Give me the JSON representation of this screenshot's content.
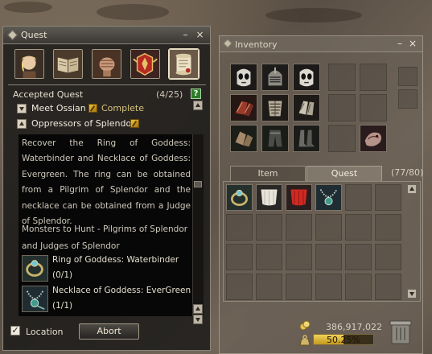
{
  "quest_window": {
    "title": "Quest",
    "minimize": "–",
    "close": "×",
    "tabs": [
      {
        "icon": "elf-portrait-icon"
      },
      {
        "icon": "open-book-icon"
      },
      {
        "icon": "fist-icon"
      },
      {
        "icon": "winged-banner-icon"
      },
      {
        "icon": "scroll-icon",
        "active": true
      }
    ],
    "accepted_label": "Accepted Quest",
    "accepted_count": "(4/25)",
    "help": "?",
    "quests": [
      {
        "name": "Meet Ossian",
        "status": "Complete",
        "expanded": false
      },
      {
        "name": "Oppressors of Splendor",
        "status": "",
        "expanded": true
      }
    ],
    "description": "Recover the Ring of Goddess: Waterbinder and Necklace of Goddess: Evergreen. The ring can be obtained from a Pilgrim of Splendor and the necklace can be obtained from a Judge of Splendor.",
    "hunt_text": "Monsters to Hunt - Pilgrims of Splendor and Judges of Splendor",
    "rewards": [
      {
        "name": "Ring of Goddess: Waterbinder",
        "count": "(0/1)",
        "icon": "ring-icon"
      },
      {
        "name": "Necklace of Goddess: EverGreen",
        "count": "(1/1)",
        "icon": "necklace-icon"
      }
    ],
    "location_label": "Location",
    "location_checked": true,
    "abort_label": "Abort"
  },
  "inventory_window": {
    "title": "Inventory",
    "minimize": "–",
    "close": "×",
    "tabs": [
      {
        "label": "Item",
        "active": false
      },
      {
        "label": "Quest",
        "active": true
      }
    ],
    "count": "(77/80)",
    "equipment_slots": [
      "skull-mask-icon",
      "knight-helmet-icon",
      "skull-mask-icon",
      "red-gauntlets-icon",
      "bone-armor-icon",
      "bone-gloves-icon",
      "leather-gloves-icon",
      "dark-leggings-icon",
      "boots-icon",
      "dragon-icon"
    ],
    "quest_items": [
      "ring-icon",
      "white-cloth-icon",
      "red-cloth-icon",
      "necklace-icon"
    ],
    "adena": "386,917,022",
    "weight_text": "50.25%",
    "weight_fraction": 0.5025
  },
  "colors": {
    "quest_bg": "#1c1b1a",
    "accent_gold": "#d7c27c",
    "weight_fill": "#e0b93a",
    "help_green": "#2f7b2b"
  }
}
